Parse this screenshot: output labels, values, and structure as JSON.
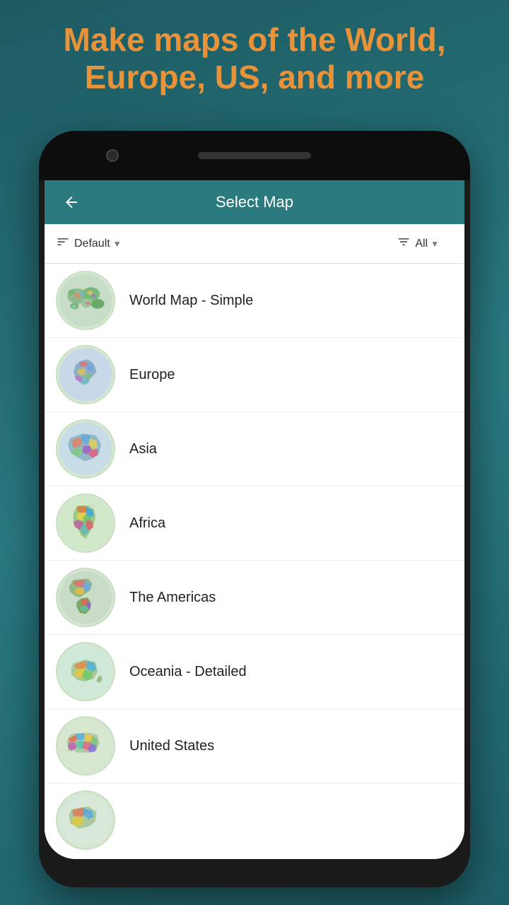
{
  "headline": {
    "line1": "Make maps of the World,",
    "line2": "Europe, US, and more"
  },
  "header": {
    "title": "Select Map",
    "back_label": "←"
  },
  "filter_bar": {
    "sort_icon": "≡",
    "sort_value": "Default",
    "filter_icon": "≡",
    "filter_value": "All"
  },
  "maps": [
    {
      "id": "world-simple",
      "label": "World Map - Simple",
      "color1": "#c8d8c0",
      "color2": "#a0c4a0"
    },
    {
      "id": "europe",
      "label": "Europe",
      "color1": "#b8cce0",
      "color2": "#6a9abf"
    },
    {
      "id": "asia",
      "label": "Asia",
      "color1": "#c4d8e0",
      "color2": "#80b0c0"
    },
    {
      "id": "africa",
      "label": "Africa",
      "color1": "#d0e0c8",
      "color2": "#a0c080"
    },
    {
      "id": "americas",
      "label": "The Americas",
      "color1": "#c8d8c0",
      "color2": "#90b880"
    },
    {
      "id": "oceania",
      "label": "Oceania - Detailed",
      "color1": "#d0e8d8",
      "color2": "#98c8a8"
    },
    {
      "id": "us",
      "label": "United States",
      "color1": "#d8e8d0",
      "color2": "#a8c8a0"
    },
    {
      "id": "more",
      "label": "...",
      "color1": "#e0e8dc",
      "color2": "#b0c8a8"
    }
  ]
}
